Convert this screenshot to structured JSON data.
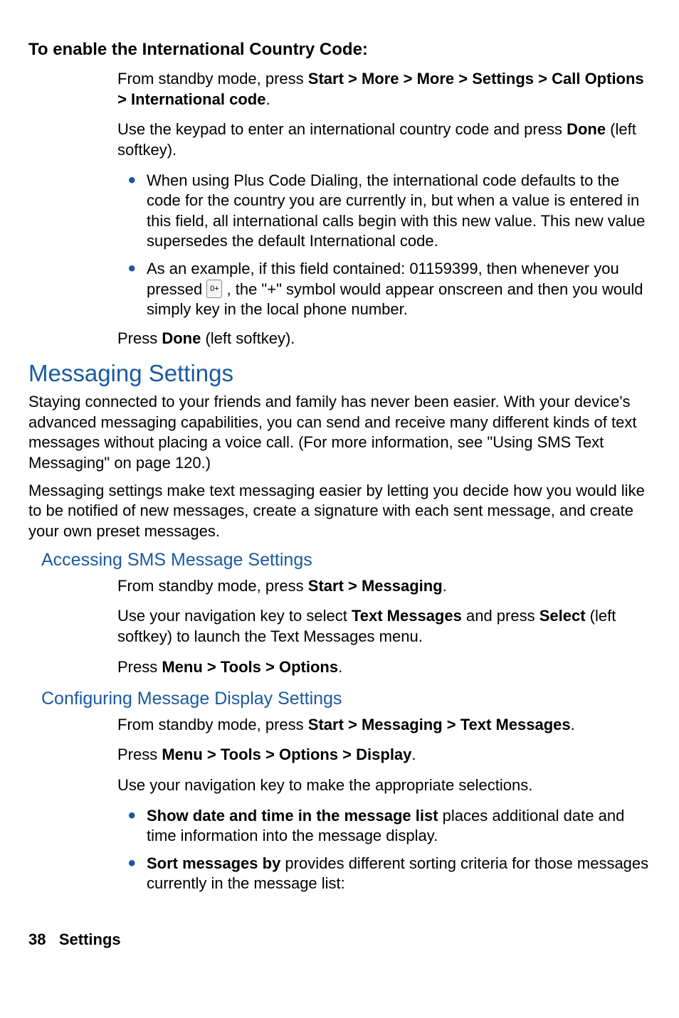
{
  "heading_intl": "To enable the International Country Code:",
  "intl_step1_pre": "From standby mode, press ",
  "intl_step1_bold": "Start > More > More > Settings > Call Options > International code",
  "intl_step1_post": ".",
  "intl_step2_pre": "Use the keypad to enter an international country code and press ",
  "intl_step2_bold": "Done",
  "intl_step2_post": " (left softkey).",
  "intl_bullet1": "When using Plus Code Dialing, the international code defaults to the code for the country you are currently in, but when a value is entered in this field, all international calls begin with this new value. This new value supersedes the default International code.",
  "intl_bullet2_pre": "As an example, if this field contained: 01159399, then whenever you pressed ",
  "intl_bullet2_key": "0+",
  "intl_bullet2_post": " , the \"+\" symbol would appear onscreen and then you would simply key in the local phone number.",
  "intl_step3_pre": "Press ",
  "intl_step3_bold": "Done",
  "intl_step3_post": " (left softkey).",
  "msg_heading": "Messaging Settings",
  "msg_para1": "Staying connected to your friends and family has never been easier. With your device's advanced messaging capabilities, you can send and receive many different kinds of text messages without placing a voice call. (For more information, see \"Using SMS Text Messaging\" on page 120.)",
  "msg_para2": "Messaging settings make text messaging easier by letting you decide how you would like to be notified of new messages, create a signature with each sent message, and create your own preset messages.",
  "sms_heading": "Accessing SMS Message Settings",
  "sms_step1_pre": "From standby mode, press ",
  "sms_step1_bold": "Start > Messaging",
  "sms_step1_post": ".",
  "sms_step2_pre": "Use your navigation key to select ",
  "sms_step2_bold1": "Text Messages",
  "sms_step2_mid": " and press ",
  "sms_step2_bold2": "Select",
  "sms_step2_post": " (left softkey) to launch the Text Messages menu.",
  "sms_step3_pre": "Press ",
  "sms_step3_bold": "Menu > Tools > Options",
  "sms_step3_post": ".",
  "cfg_heading": "Configuring Message Display Settings",
  "cfg_step1_pre": "From standby mode, press ",
  "cfg_step1_bold": "Start > Messaging > Text Messages",
  "cfg_step1_post": ".",
  "cfg_step2_pre": "Press ",
  "cfg_step2_bold": "Menu > Tools > Options > Display",
  "cfg_step2_post": ".",
  "cfg_step3": "Use your navigation key to make the appropriate selections.",
  "cfg_bullet1_bold": "Show date and time in the message list",
  "cfg_bullet1_post": " places additional date and time information into the message display.",
  "cfg_bullet2_bold": "Sort messages by",
  "cfg_bullet2_post": " provides different sorting criteria for those messages currently in the message list:",
  "footer_page": "38",
  "footer_section": "Settings"
}
